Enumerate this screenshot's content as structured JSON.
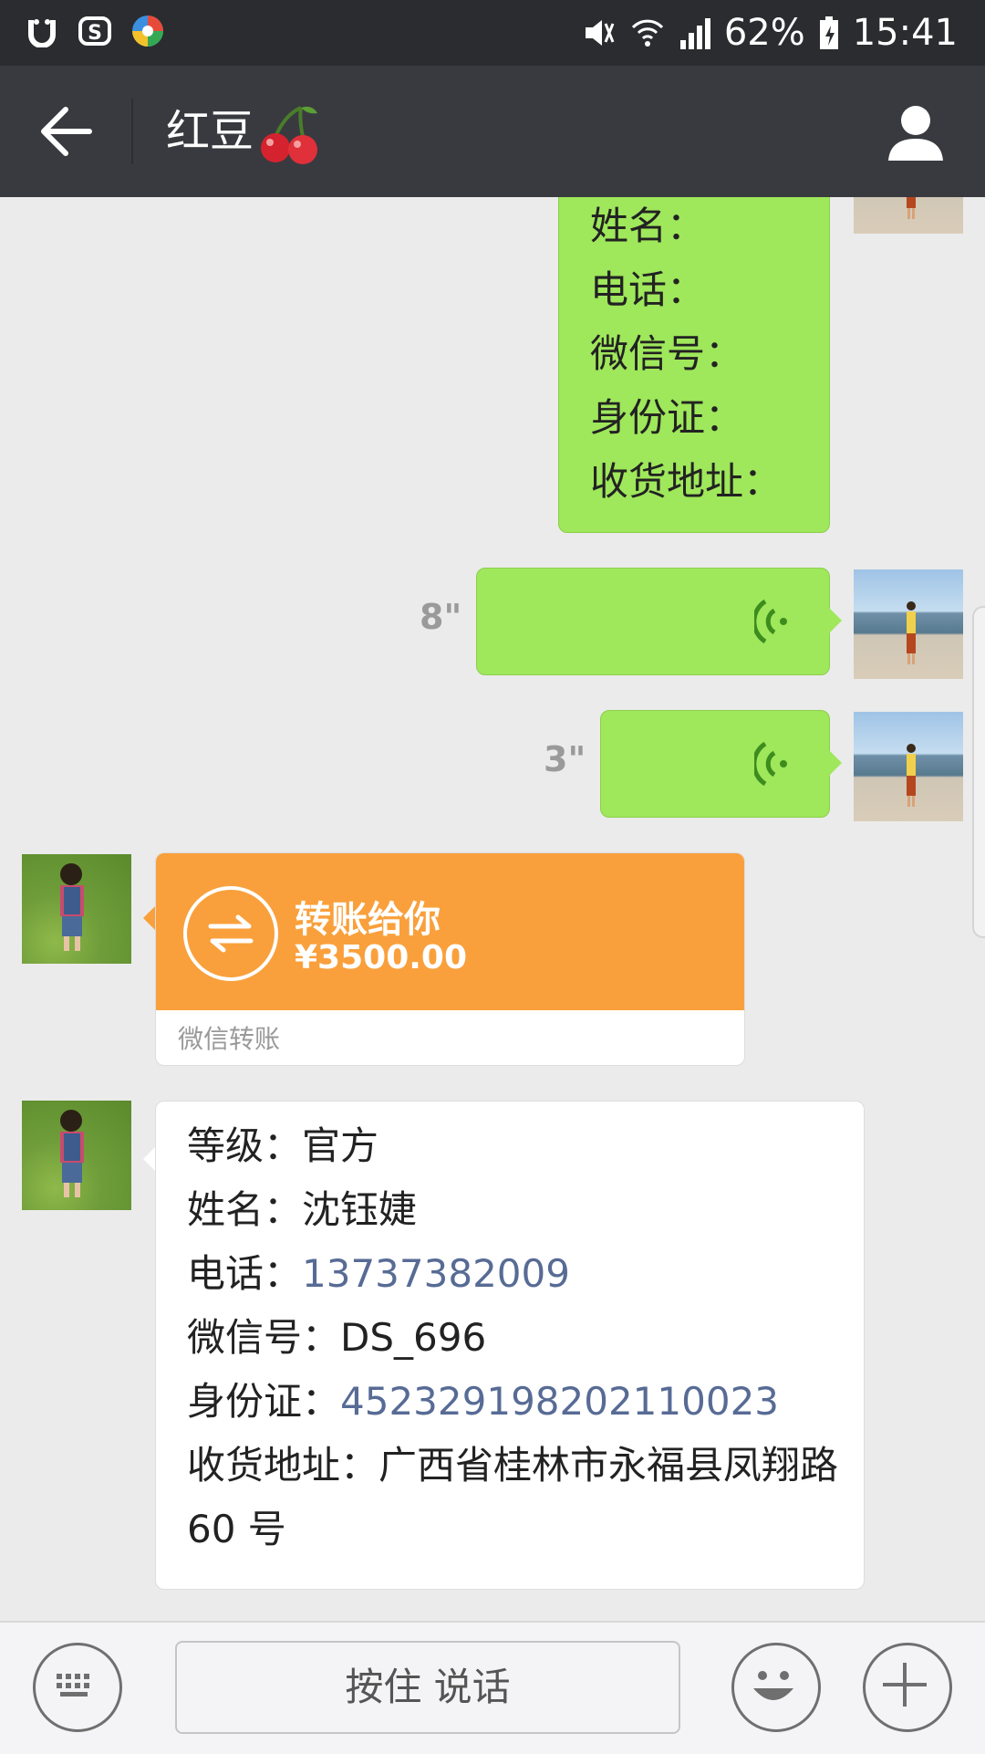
{
  "status_bar": {
    "battery": "62%",
    "time": "15:41"
  },
  "header": {
    "title": "红豆"
  },
  "messages": {
    "form_template": {
      "lines": [
        "姓名：",
        "电话：",
        "微信号：",
        "身份证：",
        "收货地址："
      ]
    },
    "voice1": {
      "duration": "8\""
    },
    "voice2": {
      "duration": "3\""
    },
    "transfer": {
      "title": "转账给你",
      "amount": "¥3500.00",
      "footer": "微信转账"
    },
    "info": {
      "level_label": "等级：",
      "level_value": "官方",
      "name_label": "姓名：",
      "name_value": "沈钰婕",
      "phone_label": "电话：",
      "phone_value": "13737382009",
      "wechat_label": "微信号：",
      "wechat_value": "DS_696",
      "id_label": "身份证：",
      "id_value": "452329198202110023",
      "address_label": "收货地址：",
      "address_value": "广西省桂林市永福县凤翔路 60 号"
    }
  },
  "input_bar": {
    "talk_label": "按住 说话"
  },
  "colors": {
    "status_bar_bg": "#2a2c2f",
    "title_bar_bg": "#393a3f",
    "chat_bg": "#ebebeb",
    "sent_bubble": "#9fe75b",
    "transfer_orange": "#f9a03c",
    "link_blue": "#576b95"
  },
  "icons": {
    "back": "back-arrow-icon",
    "profile": "profile-icon",
    "keyboard": "keyboard-icon",
    "emoji": "emoji-icon",
    "plus": "plus-icon",
    "voice": "voice-wave-icon",
    "transfer": "transfer-arrows-icon"
  }
}
